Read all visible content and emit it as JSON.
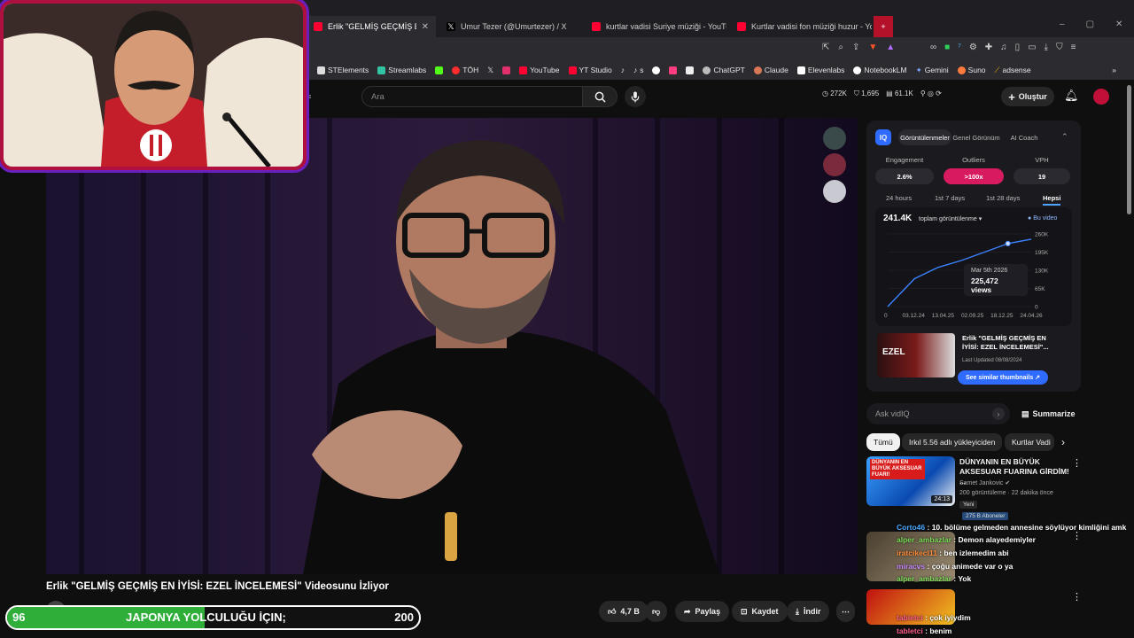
{
  "browser": {
    "tabs": [
      {
        "title": "Erlik \"GELMİŞ GEÇMİŞ EN İYİSİ: E",
        "active": true,
        "icon": "youtube-icon"
      },
      {
        "title": "Umur Tezer (@Umurtezer) / X",
        "active": false,
        "icon": "x-icon"
      },
      {
        "title": "kurtlar vadisi Suriye müziği - YouTub",
        "active": false,
        "icon": "youtube-icon"
      },
      {
        "title": "Kurtlar vadisi fon müziği huzur - You",
        "active": false,
        "icon": "youtube-icon"
      }
    ],
    "new_tab": "+",
    "bookmarks": [
      "STElements",
      "Streamlabs",
      "TÖH",
      "YouTube",
      "YT Studio",
      "s",
      "ChatGPT",
      "Claude",
      "Elevenlabs",
      "NotebookLM",
      "Gemini",
      "Suno",
      "adsense"
    ]
  },
  "youtube": {
    "search_placeholder": "Ara",
    "stats": {
      "views": "272K",
      "subs": "1,695",
      "other": "61.1K"
    },
    "create_label": "Oluştur"
  },
  "vidiq": {
    "tabs": [
      "Görüntülenmeler",
      "Genel Görünüm",
      "AI Coach"
    ],
    "metrics": [
      {
        "label": "Engagement",
        "value": "2.6%"
      },
      {
        "label": "Outliers",
        "value": ">100x"
      },
      {
        "label": "VPH",
        "value": "19"
      }
    ],
    "ranges": [
      "24 hours",
      "1st 7 days",
      "1st 28 days",
      "Hepsi"
    ],
    "total": "241.4K",
    "total_label": "toplam görüntülenme",
    "legend": "Bu video",
    "tooltip_date": "Mar 5th 2026",
    "tooltip_value": "225,472 views",
    "related_title": "Erlik \"GELMİŞ GEÇMİŞ EN İYİSİ: EZEL İNCELEMESİ\"...",
    "related_updated": "Last Updated 08/08/2024",
    "similar_btn": "See similar thumbnails",
    "ask_placeholder": "Ask vidIQ",
    "summarize": "Summarize"
  },
  "chart_data": {
    "type": "line",
    "x_ticks": [
      "0",
      "03.12.24",
      "13.04.25",
      "02.09.25",
      "18.12.25",
      "24.04.26"
    ],
    "y_ticks": [
      "260K",
      "195K",
      "130K",
      "65K",
      "0"
    ],
    "series": [
      {
        "x": [
          "03.12.24",
          "13.04.25",
          "02.09.25",
          "18.12.25",
          "Mar 5th 2026",
          "24.04.26"
        ],
        "values": [
          100000,
          140000,
          165000,
          195000,
          225472,
          241400
        ]
      }
    ],
    "ylim": [
      0,
      260000
    ]
  },
  "chips": [
    "Tümü",
    "Irkıl 5.56 adlı yükleyiciden",
    "Kurtlar Vadi"
  ],
  "recommend": {
    "title": "DÜNYANIN EN BÜYÜK AKSESUAR FUARINA GİRDİM! ...",
    "channel": "Samet Jankovic",
    "meta": "200 görüntüleme · 22 dakika önce",
    "badge": "Yeni",
    "duration": "24:13",
    "subs_tag": "275 B Aboneler",
    "thumb_text": "DÜNYANIN EN BÜYÜK AKSESUAR FUARI!"
  },
  "chat": [
    {
      "user": "Corto46",
      "msg": "10. bölüme gelmeden annesine söylüyor kimliğini amk",
      "color": "#4aa8ff"
    },
    {
      "user": "alper_ambazlar",
      "msg": "Demon alayedemiyler",
      "color": "#7ddc5a"
    },
    {
      "user": "iratcikecl11",
      "msg": "ben izlemedim abi",
      "color": "#ff8c3a"
    },
    {
      "user": "miracvs",
      "msg": "çoğu animede var o ya",
      "color": "#c98cff"
    },
    {
      "user": "alper_ambazlar",
      "msg": "Yok",
      "color": "#7ddc5a"
    },
    {
      "user": "tabletci",
      "msg": "çok iyiydim",
      "color": "#ff5c8a"
    },
    {
      "user": "tabletci",
      "msg": "benim",
      "color": "#ff5c8a"
    }
  ],
  "video": {
    "title": "Erlik \"GELMİŞ GEÇMİŞ EN İYİSİ: EZEL İNCELEMESİ\" Videosunu İzliyor",
    "likes": "4,7 B",
    "share": "Paylaş",
    "save": "Kaydet",
    "download": "İndir"
  },
  "goal": {
    "left": "96",
    "text": "JAPONYA YOLCULUĞU İÇIN;",
    "right": "200",
    "progress": 0.48
  }
}
